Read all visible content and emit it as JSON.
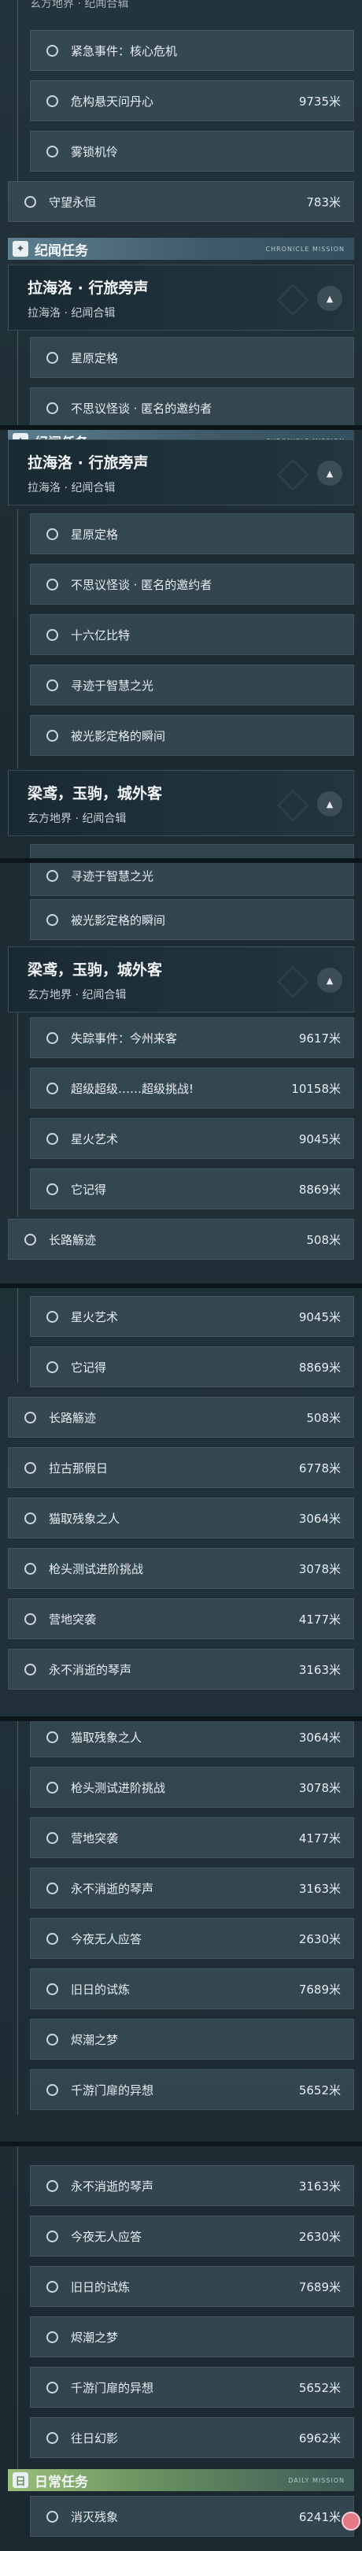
{
  "header_text": "玄方地界 · 纪闻合辑",
  "sections": [
    {
      "top_snippet": "玄方地界 · 纪闻合辑",
      "rows1": [
        {
          "label": "紧急事件：核心危机",
          "dist": "",
          "in": true
        },
        {
          "label": "危构悬天问丹心",
          "dist": "9735米",
          "in": true
        },
        {
          "label": "雾锁机伶",
          "dist": "",
          "in": true
        },
        {
          "label": "守望永恒",
          "dist": "783米",
          "in": false
        }
      ],
      "category": {
        "title": "纪闻任务",
        "tag": "CHRONICLE MISSION"
      },
      "group": {
        "title": "拉海洛 · 行旅旁声",
        "sub": "拉海洛 · 纪闻合辑"
      },
      "rows2": [
        {
          "label": "星原定格",
          "dist": ""
        },
        {
          "label": "不思议怪谈 · 匿名的邀约者",
          "dist": ""
        }
      ]
    },
    {
      "category": {
        "title": "纪闻任务",
        "tag": "CHRONICLE MISSION"
      },
      "group": {
        "title": "拉海洛 · 行旅旁声",
        "sub": "拉海洛 · 纪闻合辑"
      },
      "rows": [
        {
          "label": "星原定格",
          "dist": ""
        },
        {
          "label": "不思议怪谈 · 匿名的邀约者",
          "dist": ""
        },
        {
          "label": "十六亿比特",
          "dist": ""
        },
        {
          "label": "寻迹于智慧之光",
          "dist": ""
        },
        {
          "label": "被光影定格的瞬间",
          "dist": ""
        }
      ],
      "group2": {
        "title": "梁鸢，玉驹，城外客",
        "sub": "玄方地界 · 纪闻合辑"
      },
      "rows_after": [
        {
          "label": "寻迹于智慧之光",
          "dist": ""
        },
        {
          "label": "被光影定格的瞬间",
          "dist": ""
        }
      ]
    },
    {
      "group": {
        "title": "梁鸢，玉驹，城外客",
        "sub": "玄方地界 · 纪闻合辑"
      },
      "rows": [
        {
          "label": "失踪事件：今州来客",
          "dist": "9617米",
          "in": true
        },
        {
          "label": "超级超级……超级挑战!",
          "dist": "10158米",
          "in": true
        },
        {
          "label": "星火艺术",
          "dist": "9045米",
          "in": true
        },
        {
          "label": "它记得",
          "dist": "8869米",
          "in": true
        },
        {
          "label": "长路觞迹",
          "dist": "508米",
          "in": false
        }
      ]
    },
    {
      "rows": [
        {
          "label": "星火艺术",
          "dist": "9045米",
          "in": true
        },
        {
          "label": "它记得",
          "dist": "8869米",
          "in": true
        },
        {
          "label": "长路觞迹",
          "dist": "508米",
          "in": false
        },
        {
          "label": "拉古那假日",
          "dist": "6778米",
          "in": false
        },
        {
          "label": "猫取残象之人",
          "dist": "3064米",
          "in": false
        },
        {
          "label": "枪头测试进阶挑战",
          "dist": "3078米",
          "in": false
        },
        {
          "label": "营地突袭",
          "dist": "4177米",
          "in": false
        },
        {
          "label": "永不消逝的琴声",
          "dist": "3163米",
          "in": false
        }
      ]
    },
    {
      "rows": [
        {
          "label": "猫取残象之人",
          "dist": "3064米"
        },
        {
          "label": "枪头测试进阶挑战",
          "dist": "3078米"
        },
        {
          "label": "营地突袭",
          "dist": "4177米"
        },
        {
          "label": "永不消逝的琴声",
          "dist": "3163米"
        },
        {
          "label": "今夜无人应答",
          "dist": "2630米"
        },
        {
          "label": "旧日的试炼",
          "dist": "7689米"
        },
        {
          "label": "烬潮之梦",
          "dist": ""
        },
        {
          "label": "千游门扉的异想",
          "dist": "5652米"
        }
      ]
    },
    {
      "rows": [
        {
          "label": "永不消逝的琴声",
          "dist": "3163米"
        },
        {
          "label": "今夜无人应答",
          "dist": "2630米"
        },
        {
          "label": "旧日的试炼",
          "dist": "7689米"
        },
        {
          "label": "烬潮之梦",
          "dist": ""
        },
        {
          "label": "千游门扉的异想",
          "dist": "5652米"
        },
        {
          "label": "往日幻影",
          "dist": "6962米"
        }
      ],
      "category": {
        "title": "日常任务",
        "tag": "DAILY MISSION"
      },
      "daily_rows": [
        {
          "label": "消灭残象",
          "dist": "6241米"
        }
      ]
    }
  ]
}
